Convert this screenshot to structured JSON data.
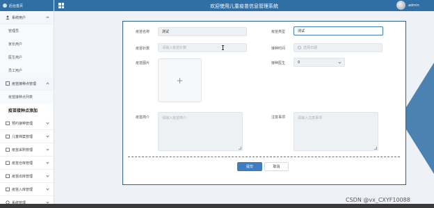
{
  "sidebar": {
    "header_title": "后台首页",
    "groups": [
      {
        "label": "系统用户",
        "open": true,
        "items": [
          "管理员",
          "家长用户",
          "医生用户",
          "员工用户"
        ]
      },
      {
        "label": "疫苗接种点管理",
        "open": true,
        "items": [
          "疫苗接种点列表",
          "疫苗接种点添加"
        ],
        "active_item": "疫苗接种点添加"
      },
      {
        "label": "预约接种管理"
      },
      {
        "label": "儿童档案管理"
      },
      {
        "label": "疫苗采购管理"
      },
      {
        "label": "疫苗仓库管理"
      },
      {
        "label": "疫苗出库管理"
      },
      {
        "label": "疫苗入库管理"
      },
      {
        "label": "系统管理"
      }
    ]
  },
  "topbar": {
    "title": "欢迎使用儿童疫苗信息管理系统",
    "user": "admin"
  },
  "form": {
    "vaccine_name": {
      "label": "疫苗名称",
      "value": "测试"
    },
    "vaccine_type": {
      "label": "疫苗类型",
      "value": "测试"
    },
    "vaccine_dose": {
      "label": "疫苗针数",
      "placeholder": "请输入疫苗针数"
    },
    "vaccination_time": {
      "label": "接种时间",
      "placeholder": "选择日期"
    },
    "vaccine_image": {
      "label": "疫苗图片",
      "upload_symbol": "+"
    },
    "doctor": {
      "label": "接种医生",
      "value": "0"
    },
    "intro": {
      "label": "疫苗简介",
      "placeholder": "请输入疫苗简介"
    },
    "notes": {
      "label": "注意事项",
      "placeholder": "请输入注意事项"
    },
    "submit_label": "提交",
    "cancel_label": "取消"
  },
  "watermark": "CSDN @vx_CXYF10088",
  "colors": {
    "primary": "#2f6fa6",
    "button": "#3f7cc1",
    "panel_border": "#2f5f8a"
  }
}
